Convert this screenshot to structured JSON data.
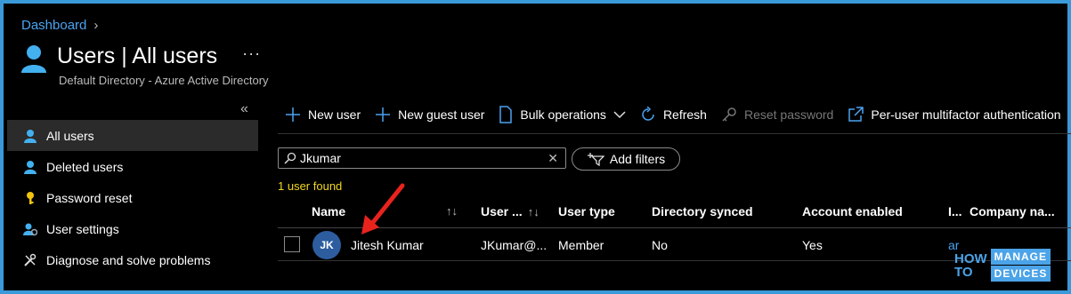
{
  "breadcrumb": {
    "item": "Dashboard"
  },
  "header": {
    "title": "Users | All users",
    "subtitle": "Default Directory - Azure Active Directory",
    "more": "···"
  },
  "sidebar": {
    "collapse": "«",
    "items": [
      {
        "label": "All users",
        "icon": "user-icon",
        "active": true
      },
      {
        "label": "Deleted users",
        "icon": "user-icon"
      },
      {
        "label": "Password reset",
        "icon": "key-icon"
      },
      {
        "label": "User settings",
        "icon": "user-settings-icon"
      },
      {
        "label": "Diagnose and solve problems",
        "icon": "wrench-icon"
      }
    ]
  },
  "toolbar": {
    "new_user": "New user",
    "new_guest_user": "New guest user",
    "bulk_operations": "Bulk operations",
    "refresh": "Refresh",
    "reset_password": "Reset password",
    "mfa": "Per-user multifactor authentication"
  },
  "search": {
    "value": "Jkumar"
  },
  "filters": {
    "add_label": "Add filters"
  },
  "results": {
    "count_text": "1 user found"
  },
  "table": {
    "columns": {
      "name": "Name",
      "upn": "User ...",
      "user_type": "User type",
      "directory_synced": "Directory synced",
      "account_enabled": "Account enabled",
      "identities": "I...",
      "company_name": "Company na..."
    },
    "rows": [
      {
        "initials": "JK",
        "name": "Jitesh Kumar",
        "upn": "JKumar@...",
        "user_type": "Member",
        "directory_synced": "No",
        "account_enabled": "Yes",
        "identities": "ar"
      }
    ]
  },
  "watermark": {
    "line1": "HOW",
    "line2": "TO",
    "brand1": "MANAGE",
    "brand2": "DEVICES"
  },
  "colors": {
    "accent": "#4aa3f0",
    "found": "#f2d61f",
    "avatar": "#2d5d9f",
    "arrow": "#e8231d",
    "border": "#3a9ad9"
  }
}
